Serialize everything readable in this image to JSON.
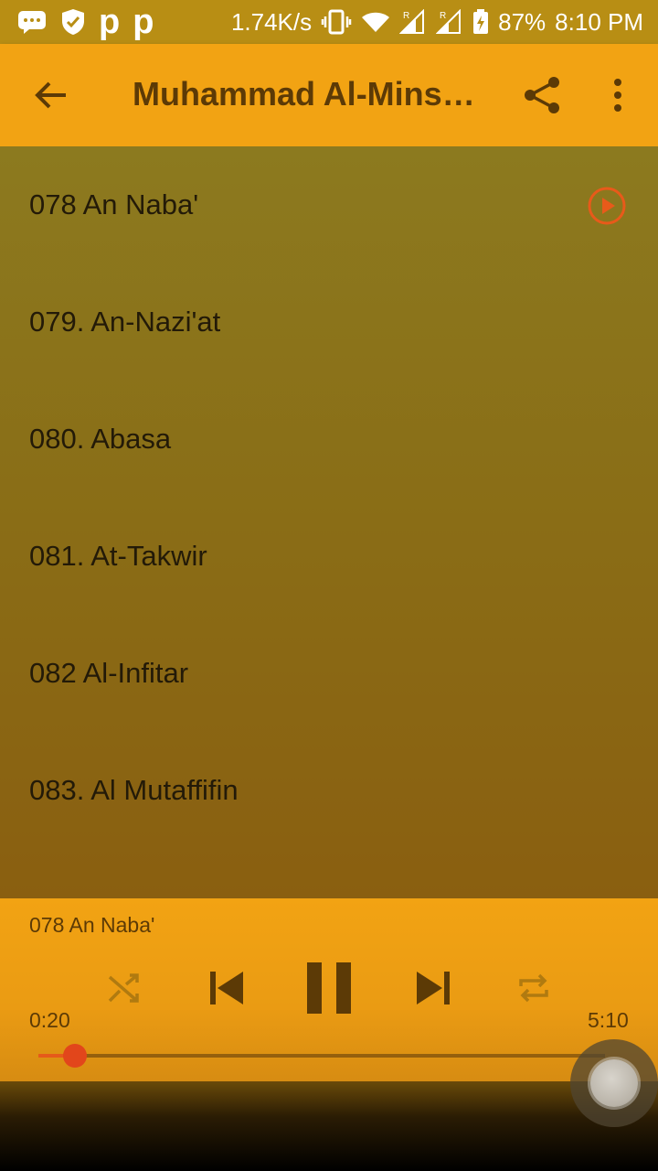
{
  "status_bar": {
    "net_speed": "1.74K/s",
    "battery": "87%",
    "time": "8:10 PM",
    "icons": [
      "message-icon",
      "shield-icon",
      "p-app-icon",
      "p-app-icon",
      "vibrate-icon",
      "wifi-icon",
      "signal-r-icon",
      "signal-r-icon",
      "battery-charging-icon"
    ]
  },
  "app_bar": {
    "title": "Muhammad Al-Minshawi",
    "back_icon": "arrow-back-icon",
    "share_icon": "share-icon",
    "more_icon": "more-vert-icon"
  },
  "tracks": [
    {
      "title": "078 An Naba'",
      "playing": true
    },
    {
      "title": "079. An-Nazi'at"
    },
    {
      "title": "080. Abasa"
    },
    {
      "title": "081. At-Takwir"
    },
    {
      "title": "082 Al-Infitar"
    },
    {
      "title": "083. Al Mutaffifin"
    }
  ],
  "player": {
    "now_playing": "078 An Naba'",
    "elapsed": "0:20",
    "total": "5:10",
    "progress": 0.0645,
    "controls": [
      "shuffle-icon",
      "skip-previous-icon",
      "pause-icon",
      "skip-next-icon",
      "repeat-icon"
    ]
  },
  "colors": {
    "accent": "#f2a313",
    "play_accent": "#e85a1a",
    "text_dark": "#5c3a06"
  }
}
